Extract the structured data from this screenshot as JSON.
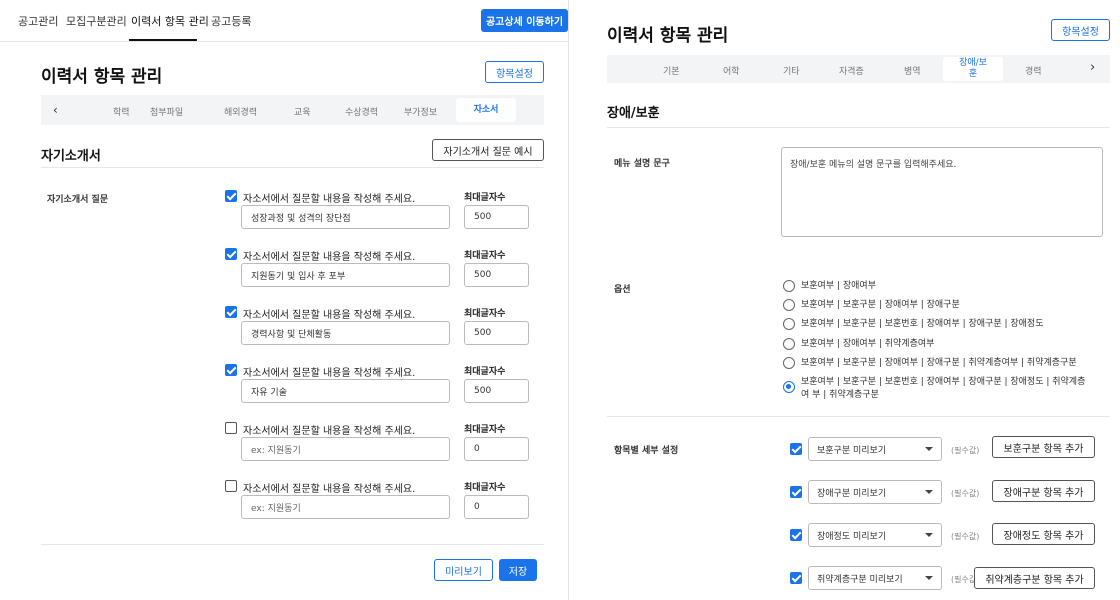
{
  "left": {
    "nav": {
      "items": [
        "공고관리",
        "모집구분관리",
        "이력서 항목 관리",
        "공고등록"
      ],
      "active_index": 2,
      "detail_button": "공고상세 이동하기"
    },
    "title": "이력서 항목 관리",
    "settings_button": "항목설정",
    "tabs": [
      "학력",
      "첨부파일",
      "해외경력",
      "교육",
      "수상경력",
      "부가정보",
      "자소서"
    ],
    "active_tab": "자소서",
    "section_title": "자기소개서",
    "example_button": "자기소개서 질문 예시",
    "row_label": "자기소개서 질문",
    "max_label": "최대글자수",
    "questions": [
      {
        "checked": true,
        "label": "자소서에서 질문할 내용을 작성해 주세요.",
        "value": "성장과정 및 성격의 장단점",
        "max": "500"
      },
      {
        "checked": true,
        "label": "자소서에서 질문할 내용을 작성해 주세요.",
        "value": "지원동기 및 입사 후 포부",
        "max": "500"
      },
      {
        "checked": true,
        "label": "자소서에서 질문할 내용을 작성해 주세요.",
        "value": "경력사항 및 단체활동",
        "max": "500"
      },
      {
        "checked": true,
        "label": "자소서에서 질문할 내용을 작성해 주세요.",
        "value": "자유 기술",
        "max": "500"
      },
      {
        "checked": false,
        "label": "자소서에서 질문할 내용을 작성해 주세요.",
        "placeholder": "ex: 지원동기",
        "max": "0"
      },
      {
        "checked": false,
        "label": "자소서에서 질문할 내용을 작성해 주세요.",
        "placeholder": "ex: 지원동기",
        "max": "0"
      }
    ],
    "preview_button": "미리보기",
    "save_button": "저장"
  },
  "right": {
    "title": "이력서 항목 관리",
    "settings_button": "항목설정",
    "tabs": [
      "기본",
      "어학",
      "기타",
      "자격증",
      "병역",
      "장애/보훈",
      "경력"
    ],
    "active_tab": "장애/보훈",
    "section_title": "장애/보훈",
    "desc_label": "메뉴 설명 문구",
    "desc_placeholder": "장애/보훈 메뉴의 설명 문구를 입력해주세요.",
    "options_label": "옵션",
    "options": [
      "보훈여부 | 장애여부",
      "보훈여부 | 보훈구분 | 장애여부 | 장애구분",
      "보훈여부 | 보훈구분 | 보훈번호 | 장애여부 | 장애구분 | 장애정도",
      "보훈여부 | 장애여부 | 취약계층여부",
      "보훈여부 | 보훈구분 | 장애여부 | 장애구분 | 취약계층여부 | 취약계층구분",
      "보훈여부 | 보훈구분 | 보훈번호 | 장애여부 | 장애구분 | 장애정도 | 취약계층여 부 | 취약계층구분"
    ],
    "selected_option": 5,
    "detail_label": "항목별 세부 설정",
    "required_hint": "(필수값)",
    "details": [
      {
        "select": "보훈구분 미리보기",
        "button": "보훈구분 항목 추가"
      },
      {
        "select": "장애구분 미리보기",
        "button": "장애구분 항목 추가"
      },
      {
        "select": "장애정도 미리보기",
        "button": "장애정도 항목 추가"
      },
      {
        "select": "취약계층구분 미리보기",
        "button": "취약계층구분 항목 추가"
      }
    ],
    "accent": "#1a73e8"
  }
}
